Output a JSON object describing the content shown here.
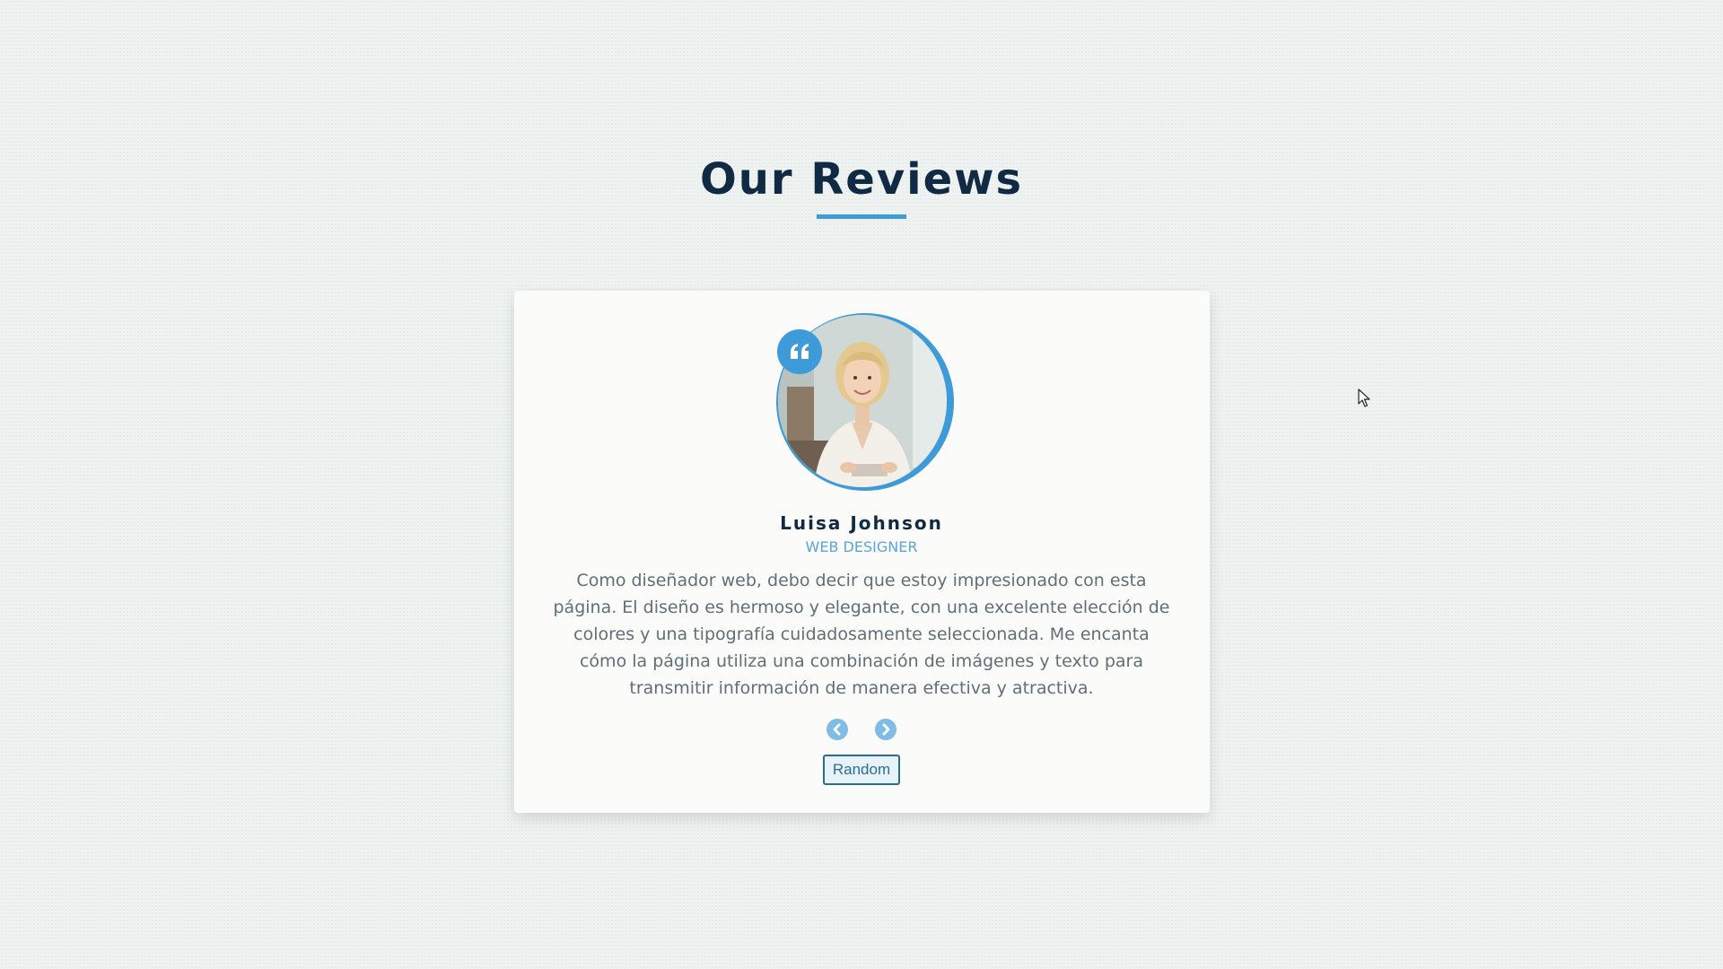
{
  "header": {
    "title": "Our Reviews"
  },
  "review": {
    "name": "Luisa Johnson",
    "job": "WEB DESIGNER",
    "text": "Como diseñador web, debo decir que estoy impresionado con esta página. El diseño es hermoso y elegante, con una excelente elección de colores y una tipografía cuidadosamente seleccionada. Me encanta cómo la página utiliza una combinación de imágenes y texto para transmitir información de manera efectiva y atractiva."
  },
  "controls": {
    "prev_icon": "chevron-left-icon",
    "next_icon": "chevron-right-icon",
    "random_label": "Random"
  },
  "icons": {
    "quote": "quote-icon"
  },
  "colors": {
    "accent": "#3d9bd9",
    "title": "#102a43",
    "text": "#5f6f77",
    "background": "#eef2f1",
    "card": "#fbfbf9"
  }
}
